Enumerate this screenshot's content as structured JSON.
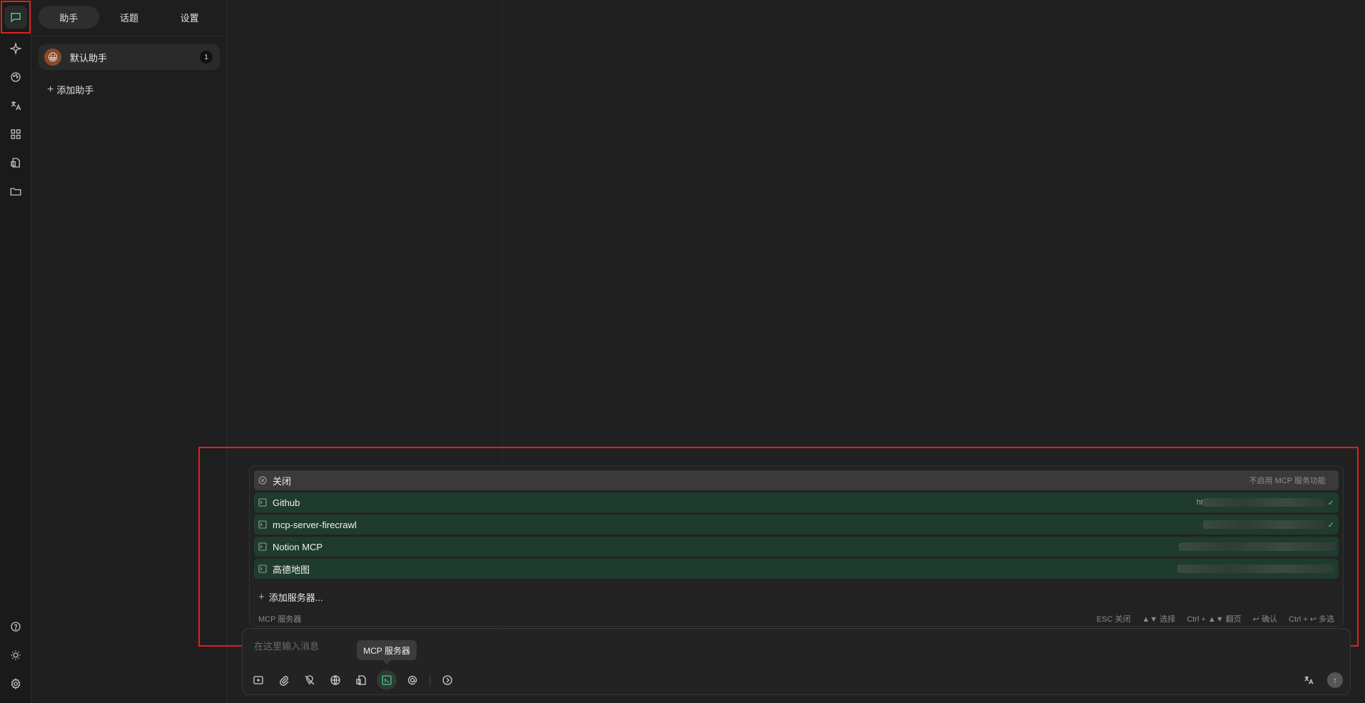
{
  "rail": {
    "items": [
      {
        "name": "chat-icon",
        "active": true
      },
      {
        "name": "sparkle-icon",
        "active": false
      },
      {
        "name": "palette-icon",
        "active": false
      },
      {
        "name": "translate-icon",
        "active": false
      },
      {
        "name": "apps-grid-icon",
        "active": false
      },
      {
        "name": "file-doc-icon",
        "active": false
      },
      {
        "name": "folder-icon",
        "active": false
      }
    ],
    "bottom": [
      {
        "name": "help-icon"
      },
      {
        "name": "theme-sun-icon"
      },
      {
        "name": "settings-gear-icon"
      }
    ]
  },
  "panel": {
    "tabs": [
      {
        "label": "助手",
        "active": true
      },
      {
        "label": "话题",
        "active": false
      },
      {
        "label": "设置",
        "active": false
      }
    ],
    "assistant": {
      "name": "默认助手",
      "count": "1",
      "avatar": "😀"
    },
    "add_label": "添加助手"
  },
  "mcp": {
    "close_label": "关闭",
    "close_hint": "不启用 MCP 服务功能",
    "servers": [
      {
        "label": "Github",
        "url_visible": "ht"
      },
      {
        "label": "mcp-server-firecrawl",
        "url_visible": ""
      },
      {
        "label": "Notion MCP",
        "url_visible": ""
      },
      {
        "label": "高德地图",
        "url_visible": ""
      }
    ],
    "add_server_label": "添加服务器...",
    "footer_title": "MCP 服务器",
    "hints": [
      "ESC 关闭",
      "▲▼ 选择",
      "Ctrl + ▲▼ 翻页",
      "↩ 确认",
      "Ctrl + ↩ 多选"
    ]
  },
  "input": {
    "placeholder": "在这里输入消息",
    "tooltip": "MCP 服务器"
  },
  "colors": {
    "accent": "#3ecf8e",
    "highlight_box": "#e02020",
    "server_row_bg": "#1f3b2e"
  }
}
